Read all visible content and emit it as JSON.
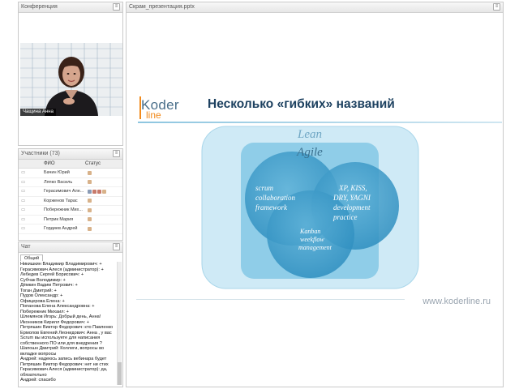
{
  "conference": {
    "title": "Конференция",
    "presenter_name": "Чащина Анна"
  },
  "participants": {
    "title": "Участники (73)",
    "col_name": "ФИО",
    "col_status": "Статус",
    "rows": [
      {
        "name": "Бачин Юрий"
      },
      {
        "name": "Ляпко Василь"
      },
      {
        "name": "Герасимович Але..."
      },
      {
        "name": "Корженов Тарас"
      },
      {
        "name": "Побережник Мих..."
      },
      {
        "name": "Петрик Мария"
      },
      {
        "name": "Гордиев Андрей"
      }
    ]
  },
  "chat": {
    "title": "Чат",
    "tab": "Общий",
    "lines": [
      "Никишкин Владимир Владимирович: +",
      "Герасимович Алеся (администратор): +",
      "Лебедев Сергей Борисович: +",
      "Субчак Володимир: +",
      "Дёмкин Вадим Петрович: +",
      "Тоган Дмитрий: +",
      "Пудов Олександр: +",
      "Офицерова Елена: +",
      "Попанова Елена Александровна: +",
      "Побережник Михаил: +",
      "Шлемянов Игорь: Добрый день, Анна!",
      "Иконников Кирилл Федорович: +",
      "Петряшин Виктор Федорович: кто Павленко",
      "Ермолов Евгений Леонидович: Анна , у вас Scrum вы используете для написания собственного ПО или для внедрения ?",
      "Шапошн Дмитрий: Коллеги, вопросы во вкладке вопросы",
      "Андрей: надеюсь запись вебинара будет",
      "Петряшин Виктор Федорович: нет ни стих",
      "Герасимович Алеся (администратор): да, обязательно",
      "Андрей: спасибо"
    ]
  },
  "presentation": {
    "title": "Скрам_презентация.pptx",
    "logo_top": "Koder",
    "logo_bottom": "line",
    "slide_title": "Несколько «гибких» названий",
    "lean": "Lean",
    "agile": "Agile",
    "scrum": [
      "scrum",
      "collaboration",
      "framework"
    ],
    "xp": [
      "XP, KISS,",
      "DRY, YAGNI",
      "development",
      "practice"
    ],
    "kanban": [
      "Kanban",
      "weekflow",
      "management"
    ],
    "footer": "www.koderline.ru"
  },
  "menu_glyph": "≡"
}
